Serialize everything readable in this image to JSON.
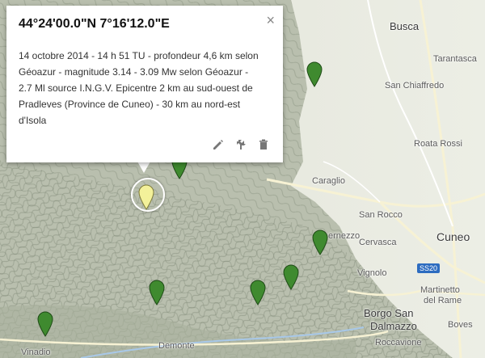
{
  "popup": {
    "title": "44°24'00.0\"N 7°16'12.0\"E",
    "description": "14 octobre 2014 - 14 h 51 TU - profondeur 4,6 km selon Géoazur - magnitude 3.14 - 3.09 Mw selon Géoazur - 2.7 Ml source I.N.G.V. Epicentre 2 km au sud-ouest de Pradleves (Province de Cuneo) - 30 km au nord-est d'Isola",
    "close_glyph": "×",
    "tools": [
      "edit-icon",
      "directions-icon",
      "delete-icon"
    ]
  },
  "places": {
    "busca": "Busca",
    "tarantasca": "Tarantasca",
    "san_chiaffredo": "San Chiaffredo",
    "roata_rossi": "Roata Rossi",
    "caraglio": "Caraglio",
    "san_rocco": "San Rocco",
    "bernezzo": "ernezzo",
    "cervasca": "Cervasca",
    "cuneo": "Cuneo",
    "vignolo": "Vignolo",
    "martinetto_1": "Martinetto",
    "martinetto_2": "del Rame",
    "borgo_1": "Borgo San",
    "borgo_2": "Dalmazzo",
    "boves": "Boves",
    "roccavione": "Roccavione",
    "demonte": "Demonte",
    "vinadio": "Vinadio",
    "road_shield": "SS20"
  },
  "colors": {
    "marker_green": "#3f8a2f",
    "marker_selected": "#f3f19a"
  }
}
